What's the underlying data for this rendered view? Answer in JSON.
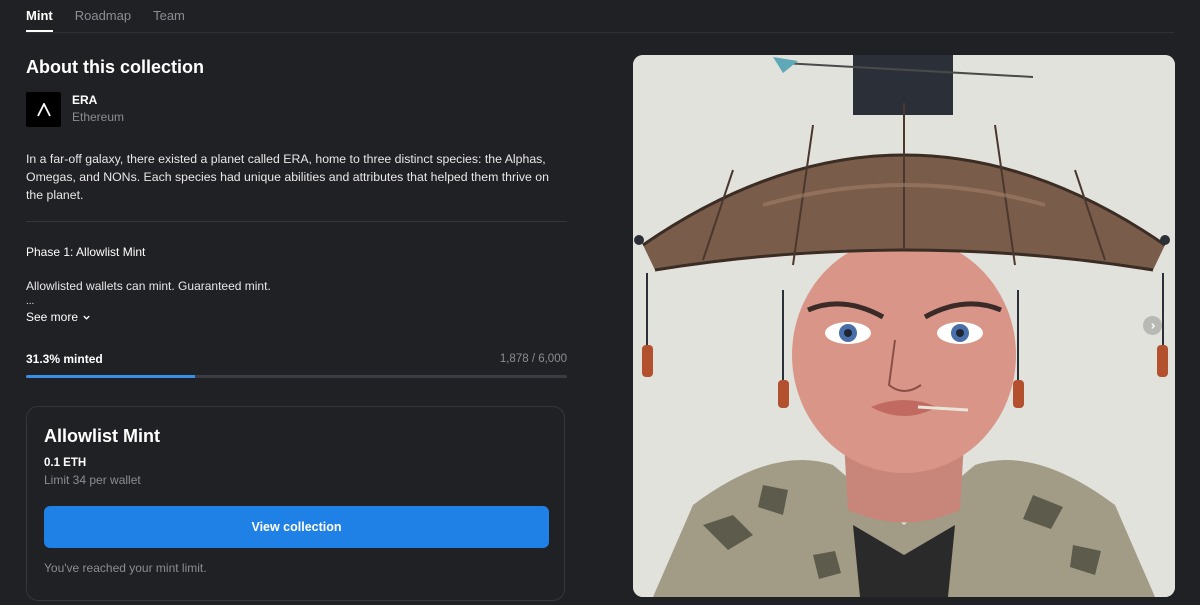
{
  "tabs": [
    {
      "label": "Mint",
      "active": true
    },
    {
      "label": "Roadmap",
      "active": false
    },
    {
      "label": "Team",
      "active": false
    }
  ],
  "collection": {
    "heading": "About this collection",
    "creator_name": "ERA",
    "creator_chain": "Ethereum",
    "description": "In a far-off galaxy, there existed a planet called ERA, home to three distinct species: the Alphas, Omegas, and NONs. Each species had unique abilities and attributes that helped them thrive on the planet.",
    "phase_title": "Phase 1: Allowlist Mint",
    "phase_description": "Allowlisted wallets can mint. Guaranteed mint.",
    "ellipsis": "...",
    "see_more": "See more"
  },
  "progress": {
    "minted_label": "31.3% minted",
    "count_label": "1,878 / 6,000",
    "fraction": 0.313
  },
  "mint_card": {
    "title": "Allowlist Mint",
    "price": "0.1 ETH",
    "limit": "Limit 34 per wallet",
    "button_label": "View collection",
    "notice": "You've reached your mint limit."
  },
  "colors": {
    "background": "#202124",
    "accent": "#1f80e5",
    "muted_text": "#8a8d93"
  },
  "icons": {
    "logo": "era-logo-icon",
    "see_more": "chevron-down-icon",
    "next": "chevron-right-icon"
  }
}
